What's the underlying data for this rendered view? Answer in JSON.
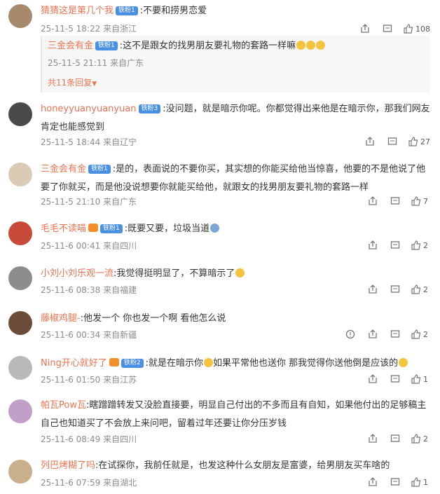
{
  "comments": [
    {
      "username": "猜猜这是第几个我",
      "badge": "铁粉1",
      "text": ":不要和捞男恋爱",
      "time": "25-11-5 18:22",
      "location": "来自浙江",
      "likes": "108",
      "reply": {
        "username": "三金会有金",
        "badge": "铁粉1",
        "text": ":这不是跟女的找男朋友要礼物的套路一样嘛",
        "time": "25-11-5 21:11",
        "location": "来自广东"
      },
      "more_replies": "共11条回复"
    },
    {
      "username": "honeyyuanyuanyuan",
      "badge": "铁粉3",
      "text": ":没问题，就是暗示你呢。你都觉得出来他是在暗示你，那我们网友肯定也能感觉到",
      "time": "25-11-5 18:44",
      "location": "来自辽宁",
      "likes": "27"
    },
    {
      "username": "三金会有金",
      "badge": "铁粉1",
      "text": ":是的，表面说的不要你买，其实想的你能买给他当惊喜，他要的不是他说了他要了你就买，而是他没说想要你就能买给他，就跟女的找男朋友要礼物的套路一样",
      "time": "25-11-5 21:10",
      "location": "来自广东",
      "likes": "7"
    },
    {
      "username": "毛毛不读喵",
      "badge": "铁粉1",
      "text": ":既要又要，垃圾当道",
      "time": "25-11-6 00:41",
      "location": "来自四川",
      "likes": "2"
    },
    {
      "username": "小刘小刘乐观一流",
      "badge": "",
      "text": ":我觉得挺明显了，不算暗示了",
      "time": "25-11-6 08:38",
      "location": "来自福建",
      "likes": "2"
    },
    {
      "username": "藤椒鸡腿-",
      "badge": "",
      "text": ":他发一个 你也发一个啊  看他怎么说",
      "time": "25-11-6 00:34",
      "location": "来自新疆",
      "likes": "2"
    },
    {
      "username": "Ning开心就好了",
      "badge": "铁粉2",
      "text_a": ":就是在暗示你",
      "text_b": "如果平常他也送你 那我觉得你送他倒是应该的",
      "time": "25-11-6 01:50",
      "location": "来自江苏",
      "likes": "1"
    },
    {
      "username": "帕瓦Pow瓦",
      "badge": "",
      "text": ":瞎蹭蹭转发又没脸直接要，明显自己付出的不多而且有自知，如果他付出的足够稿主自己也知道买了不会放上来问吧，留着过年还要让你分压岁钱",
      "time": "25-11-6 08:49",
      "location": "来自四川",
      "likes": "2"
    },
    {
      "username": "列巴烤糊了吗",
      "badge": "",
      "text": ":在试探你，我前任就是，也发这种什么女朋友是富婆，给男朋友买车啥的",
      "time": "25-11-6 07:59",
      "location": "来自湖北",
      "likes": "1"
    }
  ],
  "colors": {
    "username": "#eb7350",
    "meta": "#8c8c8c",
    "badge": "#4a90e2"
  }
}
